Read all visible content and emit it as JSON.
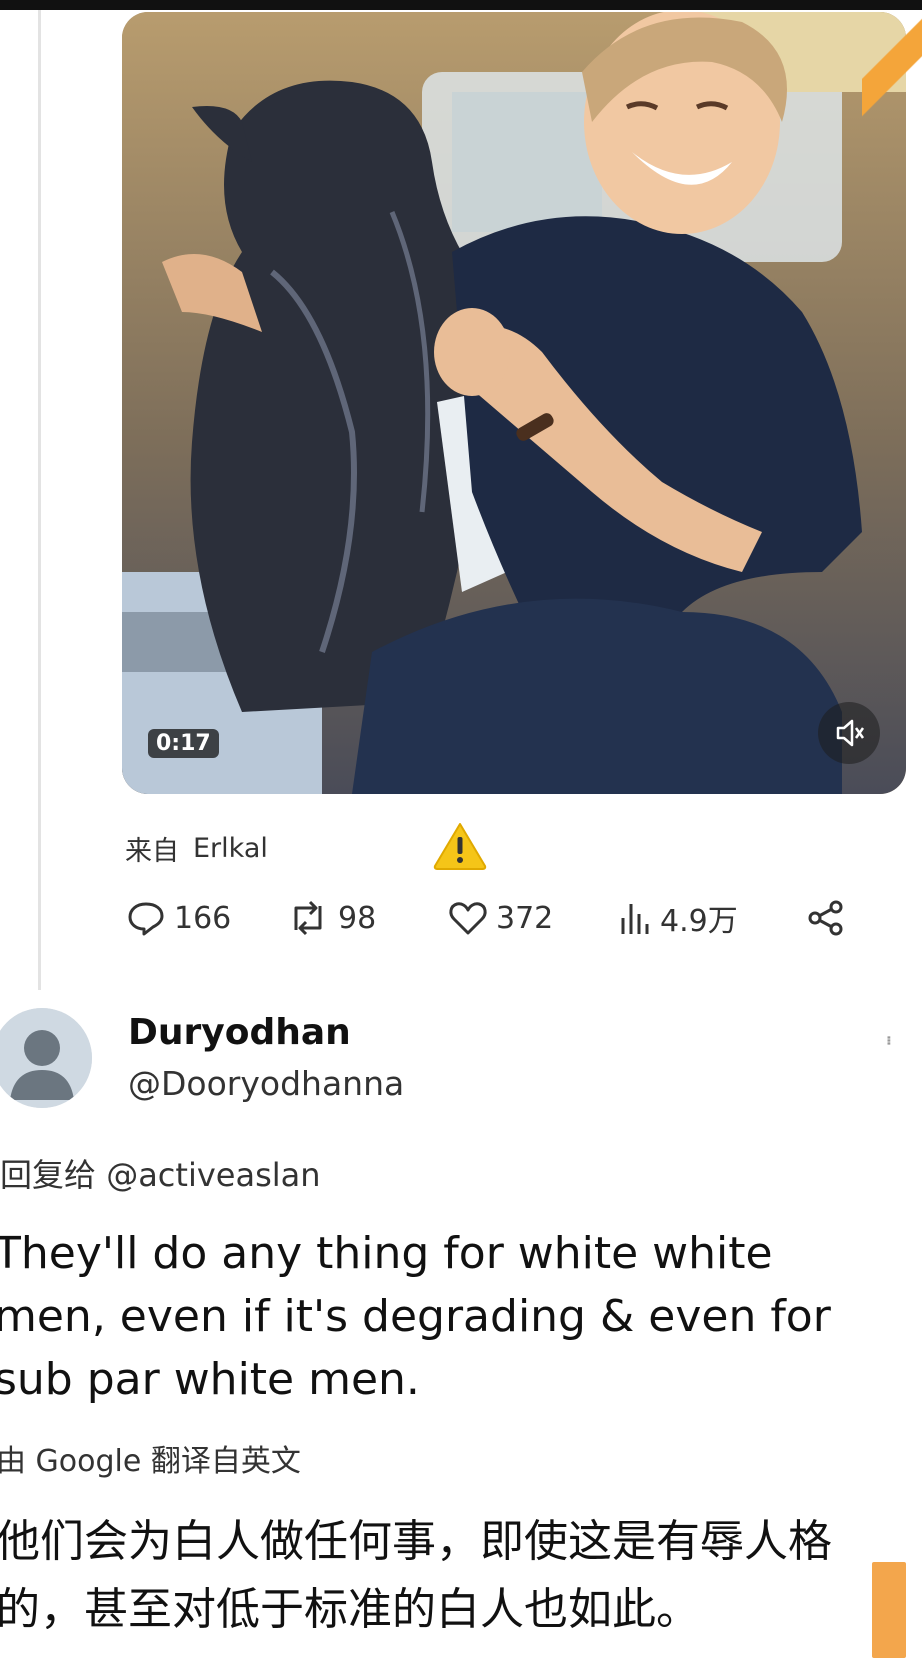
{
  "media": {
    "duration": "0:17"
  },
  "source": {
    "prefix": "来自",
    "name": "Erlkal"
  },
  "actions": {
    "replies": "166",
    "reposts": "98",
    "likes": "372",
    "views": "4.9万"
  },
  "reply": {
    "display_name": "Duryodhan",
    "handle": "@Dooryodhanna",
    "reply_to_prefix": "回复给",
    "reply_to_handle": "@activeaslan",
    "text_en": "They'll do any thing for white white men, even if it's degrading & even for sub par white men.",
    "translated_by": "由 Google 翻译自英文",
    "text_zh": "他们会为白人做任何事，即使这是有辱人格的，甚至对低于标准的白人也如此。"
  },
  "colors": {
    "warning": "#f5c518",
    "accent_orange": "#f3a64c"
  },
  "icons": [
    "reply-icon",
    "repost-icon",
    "like-icon",
    "views-icon",
    "share-icon",
    "mute-icon",
    "warning-icon",
    "avatar-icon"
  ]
}
